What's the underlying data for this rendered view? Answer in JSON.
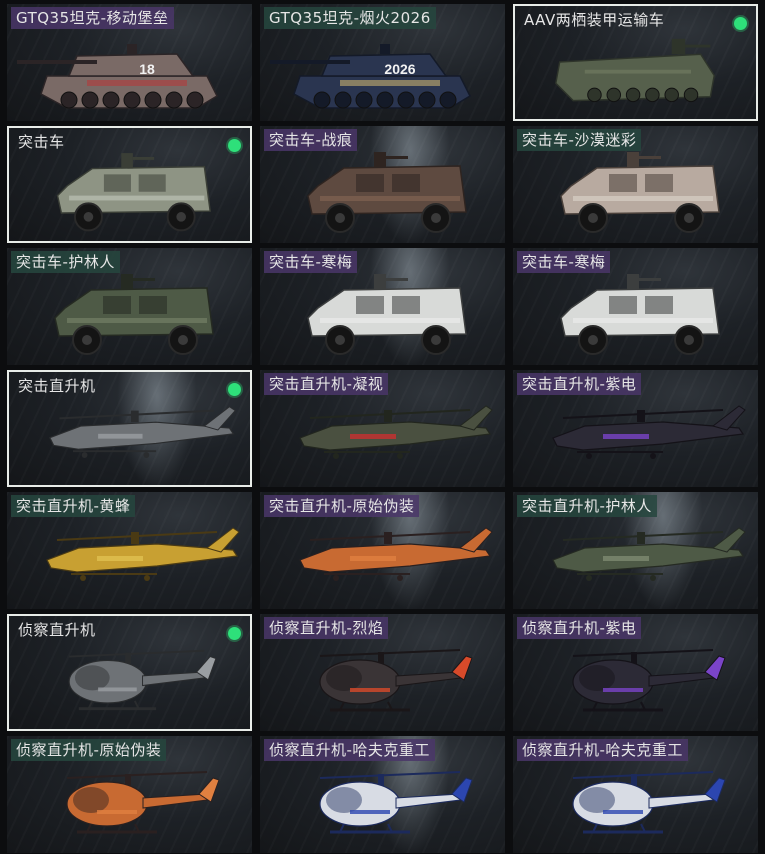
{
  "cards": [
    {
      "label": "GTQ35坦克-移动堡垒",
      "kind": "tank",
      "paint": "camo_red",
      "rarity": "purple",
      "equipped": false,
      "selected": false,
      "decal": "18"
    },
    {
      "label": "GTQ35坦克-烟火2026",
      "kind": "tank",
      "paint": "firework",
      "rarity": "green",
      "equipped": false,
      "selected": false,
      "decal": "2026"
    },
    {
      "label": "AAV两栖装甲运输车",
      "kind": "aav",
      "paint": "green_camo",
      "rarity": "plain",
      "equipped": true,
      "selected": true,
      "decal": ""
    },
    {
      "label": "突击车",
      "kind": "truck",
      "paint": "grey_camo",
      "rarity": "plain",
      "equipped": true,
      "selected": true,
      "decal": ""
    },
    {
      "label": "突击车-战痕",
      "kind": "truck",
      "paint": "rust",
      "rarity": "purple",
      "equipped": false,
      "selected": false,
      "decal": ""
    },
    {
      "label": "突击车-沙漠迷彩",
      "kind": "truck",
      "paint": "desert",
      "rarity": "green",
      "equipped": false,
      "selected": false,
      "decal": ""
    },
    {
      "label": "突击车-护林人",
      "kind": "truck",
      "paint": "forest",
      "rarity": "green",
      "equipped": false,
      "selected": false,
      "decal": ""
    },
    {
      "label": "突击车-寒梅",
      "kind": "truck",
      "paint": "white",
      "rarity": "purple",
      "equipped": false,
      "selected": false,
      "decal": ""
    },
    {
      "label": "突击车-寒梅",
      "kind": "truck",
      "paint": "white",
      "rarity": "purple",
      "equipped": false,
      "selected": false,
      "decal": ""
    },
    {
      "label": "突击直升机",
      "kind": "apache",
      "paint": "grey",
      "rarity": "plain",
      "equipped": true,
      "selected": true,
      "decal": ""
    },
    {
      "label": "突击直升机-凝视",
      "kind": "apache",
      "paint": "olive",
      "rarity": "purple",
      "equipped": false,
      "selected": false,
      "decal": ""
    },
    {
      "label": "突击直升机-紫电",
      "kind": "apache",
      "paint": "purple",
      "rarity": "purple",
      "equipped": false,
      "selected": false,
      "decal": ""
    },
    {
      "label": "突击直升机-黄蜂",
      "kind": "apache",
      "paint": "yellow",
      "rarity": "green",
      "equipped": false,
      "selected": false,
      "decal": ""
    },
    {
      "label": "突击直升机-原始伪装",
      "kind": "apache",
      "paint": "orange",
      "rarity": "purple",
      "equipped": false,
      "selected": false,
      "decal": ""
    },
    {
      "label": "突击直升机-护林人",
      "kind": "apache",
      "paint": "forest",
      "rarity": "green",
      "equipped": false,
      "selected": false,
      "decal": ""
    },
    {
      "label": "侦察直升机",
      "kind": "scout",
      "paint": "grey",
      "rarity": "plain",
      "equipped": true,
      "selected": true,
      "decal": ""
    },
    {
      "label": "侦察直升机-烈焰",
      "kind": "scout",
      "paint": "flame",
      "rarity": "purple",
      "equipped": false,
      "selected": false,
      "decal": ""
    },
    {
      "label": "侦察直升机-紫电",
      "kind": "scout",
      "paint": "purple",
      "rarity": "purple",
      "equipped": false,
      "selected": false,
      "decal": ""
    },
    {
      "label": "侦察直升机-原始伪装",
      "kind": "scout",
      "paint": "orange",
      "rarity": "green",
      "equipped": false,
      "selected": false,
      "decal": ""
    },
    {
      "label": "侦察直升机-哈夫克重工",
      "kind": "scout",
      "paint": "blue_white",
      "rarity": "purple",
      "equipped": false,
      "selected": false,
      "decal": ""
    },
    {
      "label": "侦察直升机-哈夫克重工",
      "kind": "scout",
      "paint": "blue_white",
      "rarity": "purple",
      "equipped": false,
      "selected": false,
      "decal": ""
    }
  ],
  "paints": {
    "camo_red": {
      "body": "#7a6a66",
      "dark": "#2b2426",
      "accent": "#b23a3a"
    },
    "firework": {
      "body": "#2a3550",
      "dark": "#141a28",
      "accent": "#c8b070"
    },
    "green_camo": {
      "body": "#56604c",
      "dark": "#2e342a",
      "accent": "#7a8468"
    },
    "grey_camo": {
      "body": "#8e9484",
      "dark": "#3a3e36",
      "accent": "#c8cdc2"
    },
    "rust": {
      "body": "#5e4a40",
      "dark": "#2e2420",
      "accent": "#8a6a55"
    },
    "desert": {
      "body": "#b8aaa0",
      "dark": "#4a403a",
      "accent": "#e0d8d0"
    },
    "forest": {
      "body": "#4e5a46",
      "dark": "#252a22",
      "accent": "#7e8a70"
    },
    "white": {
      "body": "#d8dad8",
      "dark": "#3c3e3e",
      "accent": "#f0f0f0"
    },
    "grey": {
      "body": "#6e7276",
      "dark": "#2a2c2e",
      "accent": "#9a9ea2"
    },
    "olive": {
      "body": "#4a5040",
      "dark": "#22261e",
      "accent": "#c83030"
    },
    "purple": {
      "body": "#2c2a36",
      "dark": "#141218",
      "accent": "#7a44c8"
    },
    "yellow": {
      "body": "#c8a032",
      "dark": "#4a3a14",
      "accent": "#e0c050"
    },
    "orange": {
      "body": "#c86a32",
      "dark": "#2a2020",
      "accent": "#e08040"
    },
    "flame": {
      "body": "#3a3436",
      "dark": "#1a1618",
      "accent": "#d84a2a"
    },
    "blue_white": {
      "body": "#d8dce4",
      "dark": "#1c2a5c",
      "accent": "#2c46b0"
    }
  }
}
